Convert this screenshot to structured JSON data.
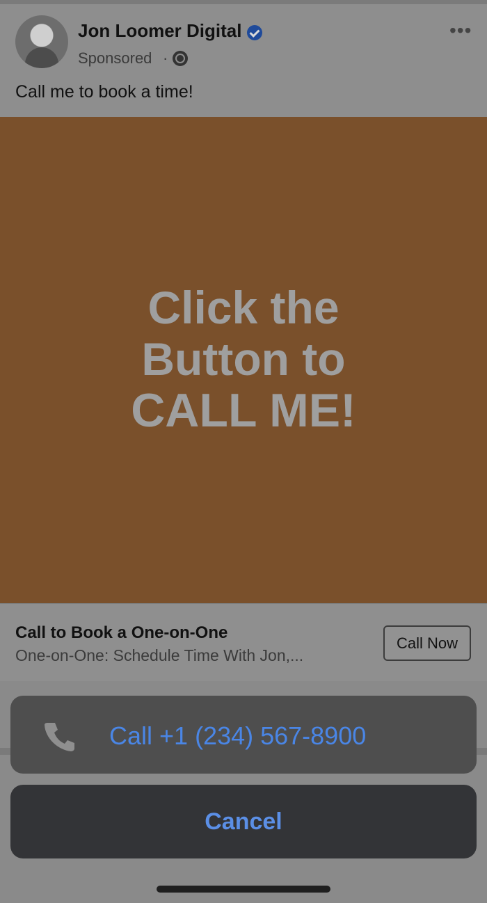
{
  "post": {
    "page_name": "Jon Loomer Digital",
    "sponsored": "Sponsored",
    "separator": "·",
    "caption": "Call me to book a time!",
    "more_icon": "more-horizontal-icon",
    "verified_icon": "verified-badge-icon",
    "globe_icon": "globe-icon"
  },
  "ad": {
    "line1": "Click the",
    "line2": "Button to",
    "line3": "CALL ME!",
    "colors": {
      "background": "#7a502b",
      "text": "#9f9f9f"
    }
  },
  "cta": {
    "title": "Call to Book a One-on-One",
    "subtitle": "One-on-One: Schedule Time With Jon,...",
    "button_label": "Call Now"
  },
  "action_sheet": {
    "call_label": "Call +1 (234) 567-8900",
    "cancel_label": "Cancel",
    "phone_icon": "phone-icon",
    "colors": {
      "link": "#4a86e6",
      "cancel": "#5b8fe6"
    }
  }
}
